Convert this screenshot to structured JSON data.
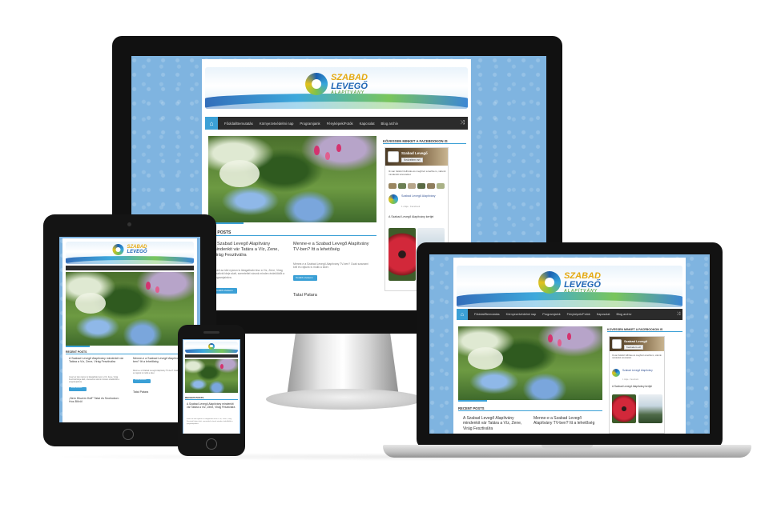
{
  "site": {
    "logo": {
      "line1": "SZABAD",
      "line2": "LEVEGŐ",
      "line3": "ALAPÍTVÁNY"
    },
    "nav": {
      "home_icon": "home-icon",
      "items": [
        "Főoldal/Bemutatás",
        "Környezetvédelmi nap",
        "Programjaink",
        "Fényképek/Fotók",
        "Kapcsolat",
        "Blog archív"
      ],
      "shuffle_icon": "shuffle-icon"
    },
    "sidebar": {
      "heading": "KÖVESSEN MINKET A FACEBOOKON IS",
      "fb_name": "Szabad Levegő",
      "fb_like": "Kedvelem ezt",
      "fb_text": "Itt van hétközi felhívás és meghívó a kertbe is, várunk mindenkit szeretettel.",
      "fb_post_name": "Szabad Levegő Alapítvány",
      "fb_post_meta": "1 órája · Facebook",
      "fb_caption": "A Szabad Levegő Alapítvány kertjei"
    },
    "recent": {
      "heading": "RECENT POSTS",
      "heading_short": "ENT POSTS",
      "posts": [
        {
          "title": "A Szabad Levegő Alapítvány mindenkit vár Tatára a Víz, Zene, Virág Fesztiválra",
          "excerpt": "A kert az idei nyáron is látogatható lesz a Víz, Zene, Virág Fesztivál ideje alatt, szeretettel várunk minden érdeklődőt a programjainkra.",
          "button": "Tovább olvasom"
        },
        {
          "title": "Menne-e a Szabad Levegő Alapítvány TV-ben? Itt a lehetőség",
          "excerpt": "Menne-e a Szabad Levegő Alapítvány TV-ben? Csak szavazni kell és rajtunk is múlik a siker.",
          "button": "Tovább olvasom"
        }
      ],
      "third_title": "Tatai Patara",
      "tablet_extra_title": "„Nem Hiszem Hoff\" Tatai és Szolnokon: Hoz-Bővül"
    }
  }
}
